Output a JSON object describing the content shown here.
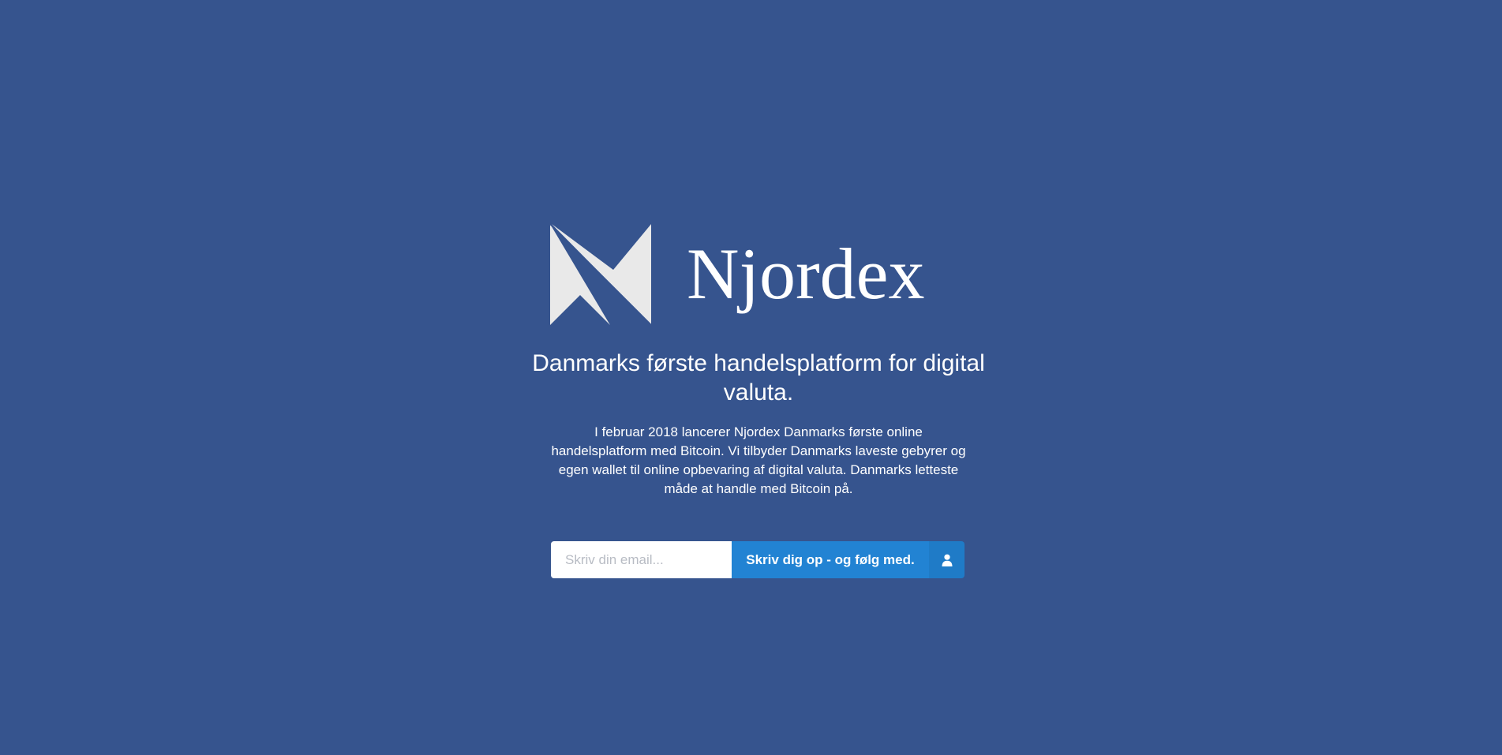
{
  "brand": {
    "name": "Njordex",
    "logo_icon": "njordex-n-logo"
  },
  "hero": {
    "tagline": "Danmarks første handelsplatform for digital valuta.",
    "description": "I februar 2018 lancerer Njordex Danmarks første online handelsplatform med Bitcoin. Vi tilbyder Danmarks laveste gebyrer og egen wallet til online opbevaring af digital valuta. Danmarks letteste måde at handle med Bitcoin på."
  },
  "signup": {
    "email_placeholder": "Skriv din email...",
    "email_value": "",
    "submit_label": "Skriv dig op - og følg med.",
    "submit_icon": "user-icon"
  },
  "colors": {
    "background": "#36548e",
    "button": "#2283d3",
    "button_addon": "#1f7bc7",
    "logo_fill": "#e9e9e9",
    "text": "#ffffff"
  }
}
